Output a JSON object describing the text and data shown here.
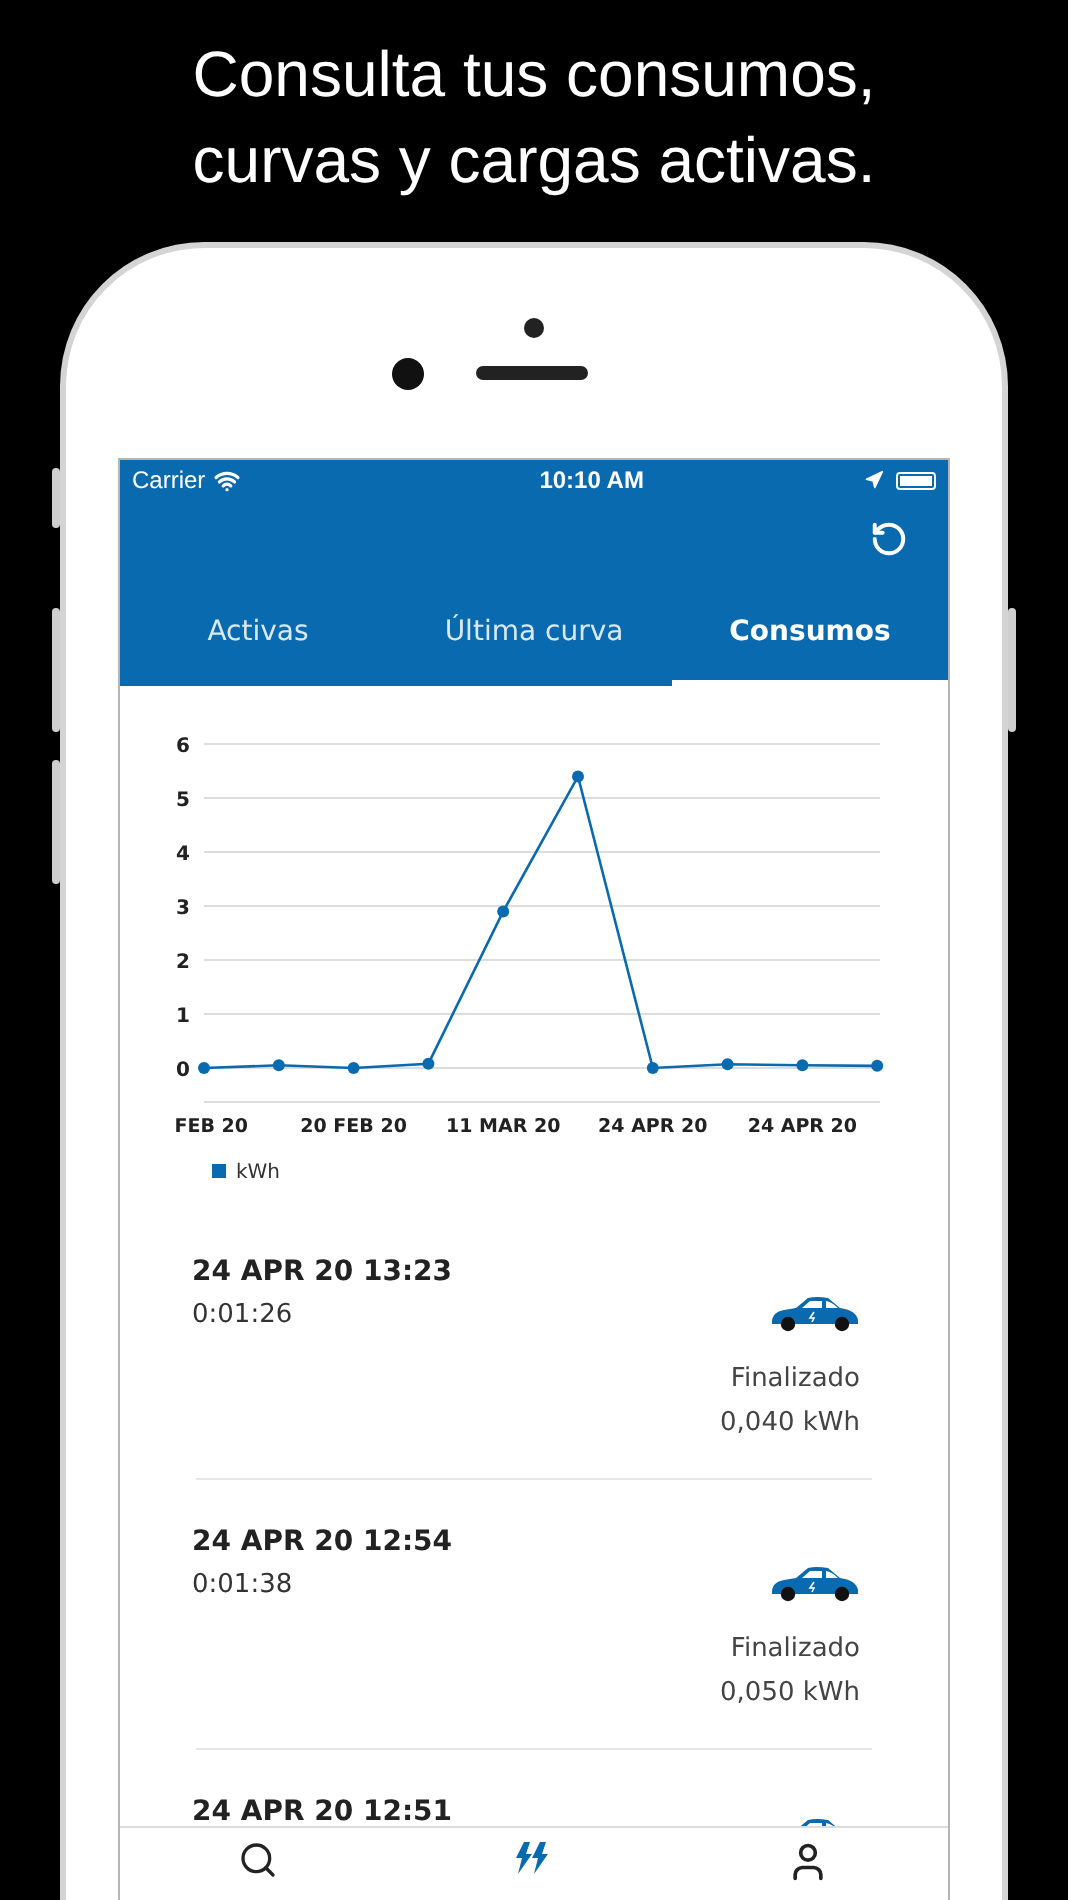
{
  "headline": [
    "Consulta tus consumos,",
    "curvas y cargas activas."
  ],
  "status_bar": {
    "carrier": "Carrier",
    "time": "10:10 AM"
  },
  "tabs": [
    {
      "label": "Activas",
      "selected": false
    },
    {
      "label": "Última curva",
      "selected": false
    },
    {
      "label": "Consumos",
      "selected": true
    }
  ],
  "chart_data": {
    "type": "line",
    "categories": [
      "FEB 20",
      null,
      "20 FEB 20",
      null,
      "11 MAR 20",
      null,
      "24 APR 20",
      null,
      "24 APR 20",
      null
    ],
    "ylim": [
      0,
      6
    ],
    "grid": true,
    "yticks": [
      0,
      1,
      2,
      3,
      4,
      5,
      6
    ],
    "series": [
      {
        "name": "kWh",
        "color": "#0a6ab0",
        "marker": "circle",
        "values": [
          0,
          0.05,
          0,
          0.08,
          2.9,
          5.4,
          0,
          0.07,
          0.05,
          0.04
        ]
      }
    ]
  },
  "sessions": [
    {
      "title": "24 APR 20 13:23",
      "duration": "0:01:26",
      "status": "Finalizado",
      "energy": "0,040 kWh"
    },
    {
      "title": "24 APR 20 12:54",
      "duration": "0:01:38",
      "status": "Finalizado",
      "energy": "0,050 kWh"
    },
    {
      "title": "24 APR 20 12:51"
    }
  ],
  "bottom_tabs": [
    {
      "kind": "search",
      "selected": false
    },
    {
      "kind": "charge",
      "selected": true
    },
    {
      "kind": "profile",
      "selected": false
    }
  ]
}
